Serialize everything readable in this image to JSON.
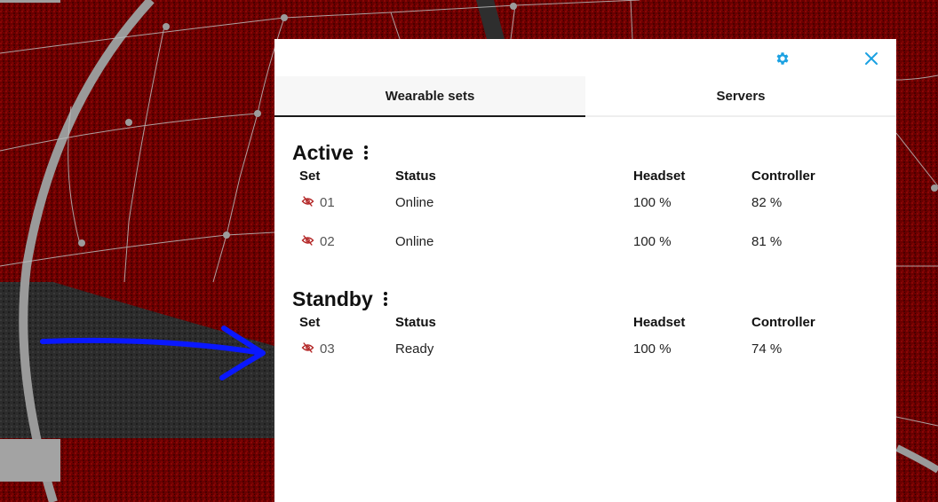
{
  "panel": {
    "settings_icon": "gear-icon",
    "close_icon": "close-icon",
    "accent_color": "#1ba1e2"
  },
  "tabs": [
    {
      "label": "Wearable sets",
      "active": true
    },
    {
      "label": "Servers",
      "active": false
    }
  ],
  "columns": {
    "set": "Set",
    "status": "Status",
    "headset": "Headset",
    "controller": "Controller"
  },
  "sections": [
    {
      "title": "Active",
      "rows": [
        {
          "set": "01",
          "status": "Online",
          "headset": "100 %",
          "controller": "82 %"
        },
        {
          "set": "02",
          "status": "Online",
          "headset": "100 %",
          "controller": "81 %"
        }
      ]
    },
    {
      "title": "Standby",
      "rows": [
        {
          "set": "03",
          "status": "Ready",
          "headset": "100 %",
          "controller": "74 %"
        }
      ]
    }
  ],
  "visibility_icon": "eye-off-icon",
  "visibility_icon_color": "#b22222"
}
